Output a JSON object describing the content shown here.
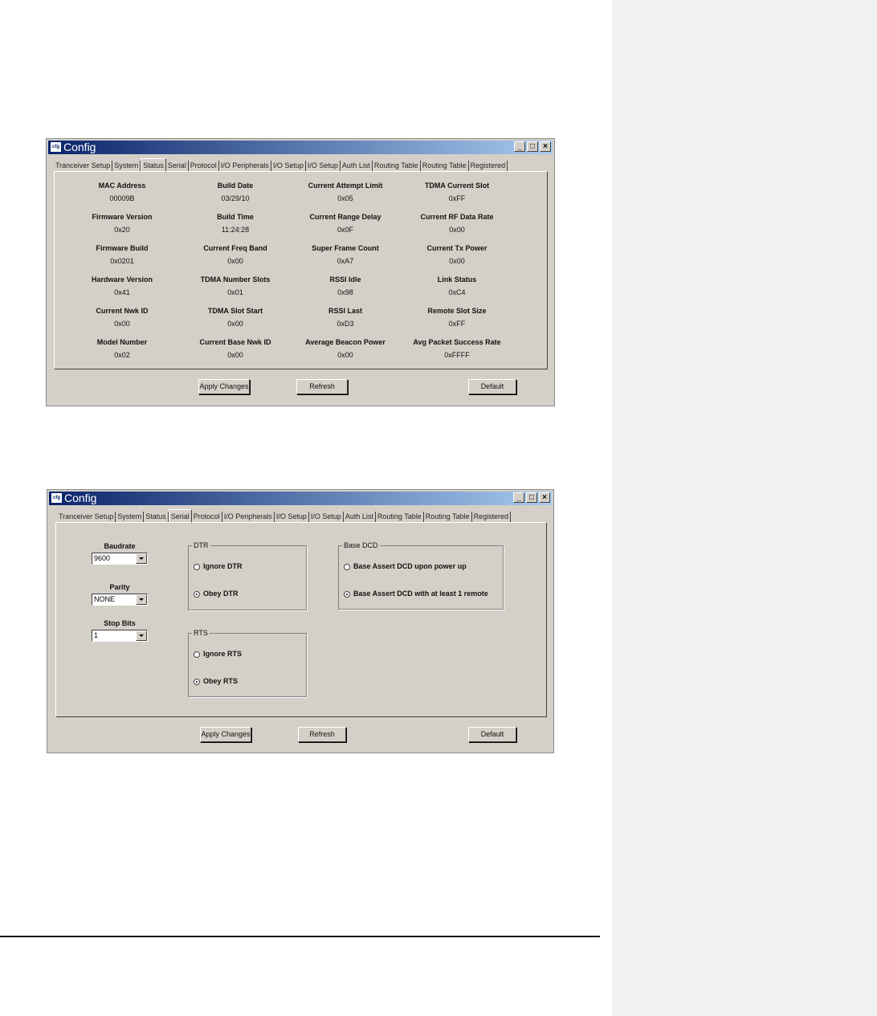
{
  "window": {
    "title": "Config",
    "controls": {
      "minimize": "_",
      "maximize": "□",
      "close": "×"
    }
  },
  "tabs": [
    "Tranceiver Setup",
    "System",
    "Status",
    "Serial",
    "Protocol",
    "I/O Peripherals",
    "I/O Setup",
    "I/O Setup",
    "Auth List",
    "Routing Table",
    "Routing Table",
    "Registered"
  ],
  "status_window": {
    "active_tab": "Status",
    "fields": [
      {
        "label": "MAC Address",
        "value": "00009B"
      },
      {
        "label": "Build Date",
        "value": "03/29/10"
      },
      {
        "label": "Current Attempt Limit",
        "value": "0x05"
      },
      {
        "label": "TDMA Current Slot",
        "value": "0xFF"
      },
      {
        "label": "Firmware Version",
        "value": "0x20"
      },
      {
        "label": "Build Time",
        "value": "11:24:28"
      },
      {
        "label": "Current Range Delay",
        "value": "0x0F"
      },
      {
        "label": "Current RF Data Rate",
        "value": "0x00"
      },
      {
        "label": "Firmware Build",
        "value": "0x0201"
      },
      {
        "label": "Current Freq Band",
        "value": "0x00"
      },
      {
        "label": "Super Frame Count",
        "value": "0xA7"
      },
      {
        "label": "Current Tx Power",
        "value": "0x00"
      },
      {
        "label": "Hardware Version",
        "value": "0x41"
      },
      {
        "label": "TDMA Number Slots",
        "value": "0x01"
      },
      {
        "label": "RSSI Idle",
        "value": "0x98"
      },
      {
        "label": "Link Status",
        "value": "0xC4"
      },
      {
        "label": "Current Nwk ID",
        "value": "0x00"
      },
      {
        "label": "TDMA Slot Start",
        "value": "0x00"
      },
      {
        "label": "RSSI Last",
        "value": "0xD3"
      },
      {
        "label": "Remote Slot Size",
        "value": "0xFF"
      },
      {
        "label": "Model Number",
        "value": "0x02"
      },
      {
        "label": "Current Base Nwk ID",
        "value": "0x00"
      },
      {
        "label": "Average Beacon Power",
        "value": "0x00"
      },
      {
        "label": "Avg Packet Success Rate",
        "value": "0xFFFF"
      }
    ],
    "buttons": {
      "apply": "Apply Changes",
      "refresh": "Refresh",
      "default": "Default"
    }
  },
  "serial_window": {
    "active_tab": "Serial",
    "baudrate": {
      "label": "Baudrate",
      "value": "9600"
    },
    "parity": {
      "label": "Parity",
      "value": "NONE"
    },
    "stop_bits": {
      "label": "Stop Bits",
      "value": "1"
    },
    "dtr": {
      "title": "DTR",
      "options": [
        "Ignore DTR",
        "Obey DTR"
      ],
      "selected": "Obey DTR"
    },
    "rts": {
      "title": "RTS",
      "options": [
        "Ignore RTS",
        "Obey RTS"
      ],
      "selected": "Obey RTS"
    },
    "base_dcd": {
      "title": "Base DCD",
      "options": [
        "Base Assert DCD upon power up",
        "Base Assert DCD with at least 1 remote"
      ],
      "selected": "Base Assert DCD with at least 1 remote"
    },
    "buttons": {
      "apply": "Apply Changes",
      "refresh": "Refresh",
      "default": "Default"
    }
  }
}
